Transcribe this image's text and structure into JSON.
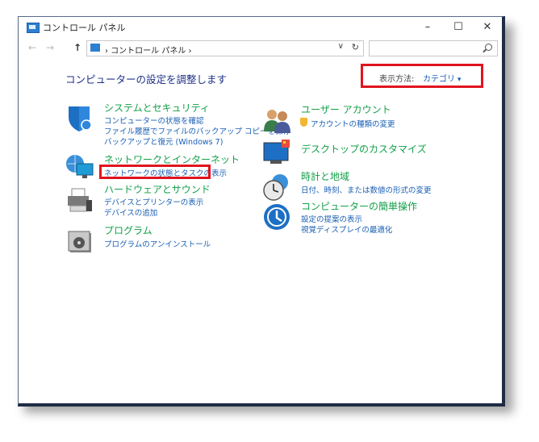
{
  "window": {
    "title": "コントロール パネル",
    "minimize": "–",
    "maximize": "☐",
    "close": "✕"
  },
  "address": {
    "back": "←",
    "forward": "→",
    "up": "↑",
    "breadcrumb": "› コントロール パネル ›",
    "dropdown": "∨",
    "refresh": "↻",
    "search_placeholder": ""
  },
  "main": {
    "heading": "コンピューターの設定を調整します",
    "view_by": {
      "label": "表示方法:",
      "value": "カテゴリ"
    }
  },
  "categories": {
    "system": {
      "title": "システムとセキュリティ",
      "links": [
        "コンピューターの状態を確認",
        "ファイル履歴でファイルのバックアップ コピーを保存",
        "バックアップと復元 (Windows 7)"
      ]
    },
    "network": {
      "title": "ネットワークとインターネット",
      "links": [
        "ネットワークの状態とタスクの表示"
      ]
    },
    "hardware": {
      "title": "ハードウェアとサウンド",
      "links": [
        "デバイスとプリンターの表示",
        "デバイスの追加"
      ]
    },
    "programs": {
      "title": "プログラム",
      "links": [
        "プログラムのアンインストール"
      ]
    },
    "users": {
      "title": "ユーザー アカウント",
      "links": [
        "アカウントの種類の変更"
      ]
    },
    "appearance": {
      "title": "デスクトップのカスタマイズ",
      "links": []
    },
    "clock": {
      "title": "時計と地域",
      "links": [
        "日付、時刻、または数値の形式の変更"
      ]
    },
    "ease": {
      "title": "コンピューターの簡単操作",
      "links": [
        "設定の提案の表示",
        "視覚ディスプレイの最適化"
      ]
    }
  },
  "colors": {
    "highlight": "#e0141e",
    "category_title": "#13a049",
    "link": "#1a5fb4",
    "heading": "#1e3287"
  }
}
